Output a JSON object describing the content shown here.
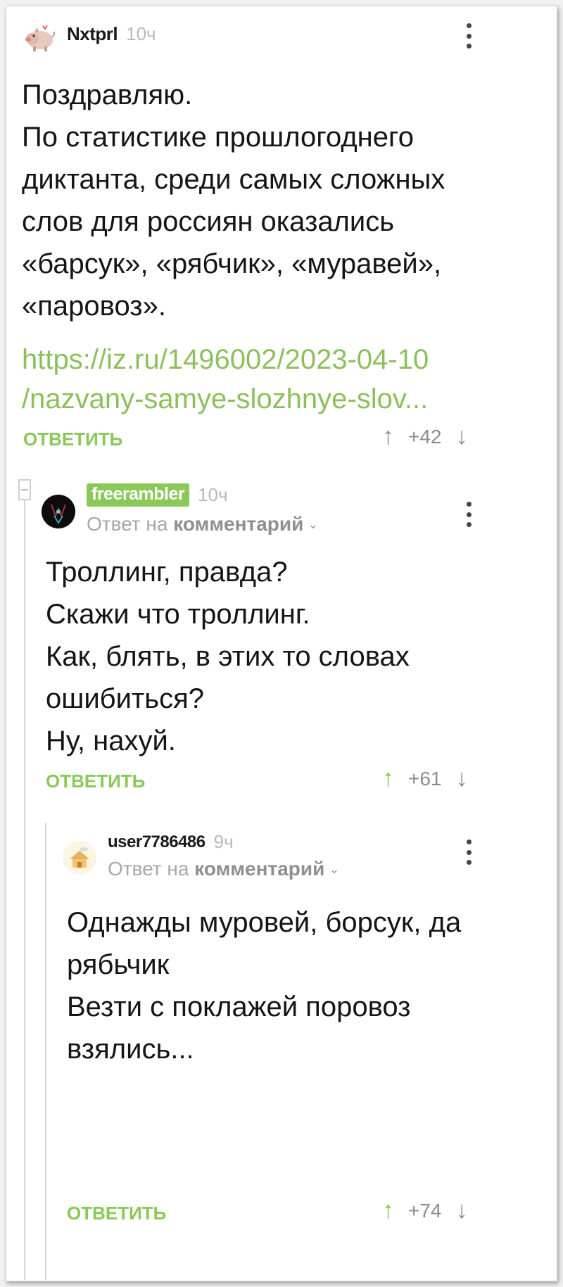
{
  "comments": [
    {
      "username": "Nxtprl",
      "time": "10ч",
      "body": "Поздравляю.\nПо статистике прошлогоднего\nдиктанта, среди самых сложных\nслов для россиян оказались\n«барсук», «рябчик», «муравей»,\n«паровоз».",
      "link": "https://iz.ru/1496002/2023-04-10\n/nazvany-samye-slozhnye-slov...",
      "reply_label": "ОТВЕТИТЬ",
      "rating": "+42"
    },
    {
      "username": "freerambler",
      "time": "10ч",
      "reply_prefix": "Ответ на",
      "reply_target": "комментарий",
      "body": "Троллинг, правда?\nСкажи что троллинг.\nКак, блять, в этих то словах\nошибиться?\nНу, нахуй.",
      "reply_label": "ОТВЕТИТЬ",
      "rating": "+61"
    },
    {
      "username": "user7786486",
      "time": "9ч",
      "reply_prefix": "Ответ на",
      "reply_target": "комментарий",
      "body": "Однажды муровей, борсук, да\nрябьчик\nВезти с поклажей поровоз\nвзялись...",
      "reply_label": "ОТВЕТИТЬ",
      "rating": "+74"
    }
  ],
  "icons": {
    "upvote": "↑",
    "downvote": "↓",
    "chevron": "⌄"
  },
  "colors": {
    "accent_green": "#8ac858",
    "link_green": "#8cc05b",
    "upvoted_arrow": "#7cc24a"
  }
}
